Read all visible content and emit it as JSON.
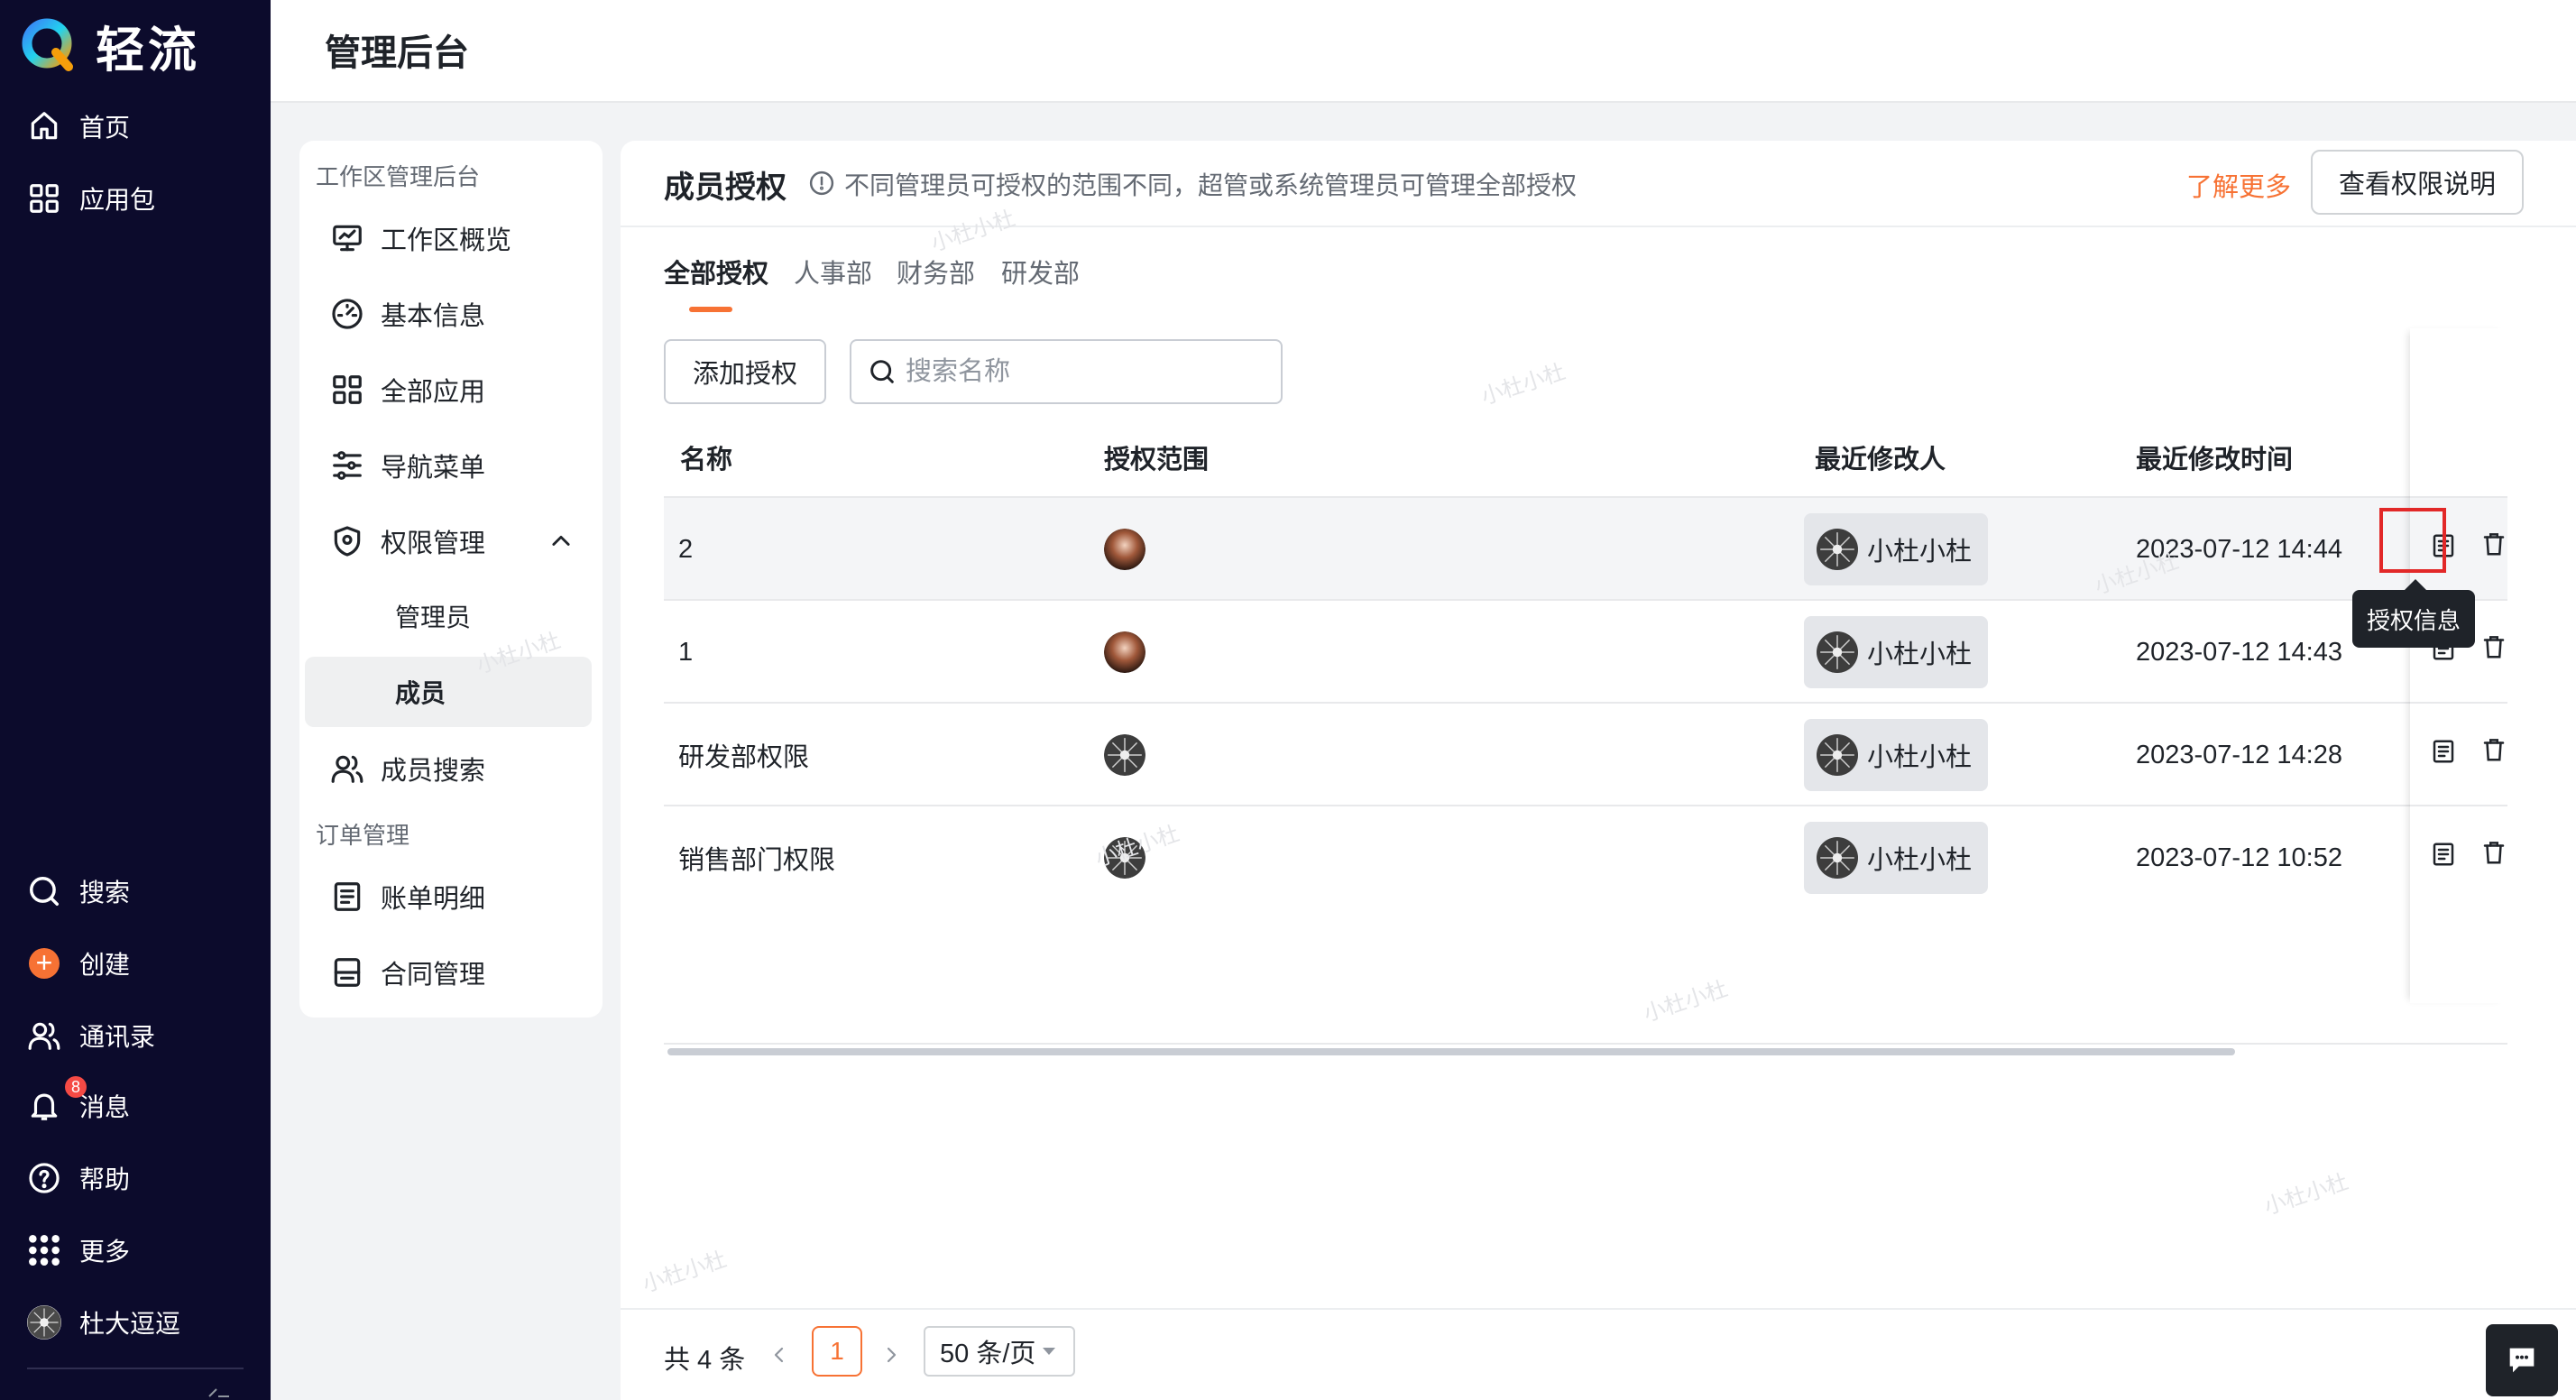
{
  "app": {
    "brand_name": "轻流",
    "header_title": "管理后台"
  },
  "sidebar": {
    "top_items": [
      {
        "label": "首页",
        "icon": "home-icon"
      },
      {
        "label": "应用包",
        "icon": "grid-icon"
      }
    ],
    "bottom_items": [
      {
        "label": "搜索",
        "icon": "search-icon"
      },
      {
        "label": "创建",
        "icon": "plus-icon"
      },
      {
        "label": "通讯录",
        "icon": "contacts-icon"
      },
      {
        "label": "消息",
        "icon": "bell-icon",
        "badge": "8"
      },
      {
        "label": "帮助",
        "icon": "help-icon"
      },
      {
        "label": "更多",
        "icon": "dots-grid-icon"
      }
    ],
    "user_name": "杜大逗逗"
  },
  "submenu": {
    "group1": "工作区管理后台",
    "items": [
      {
        "label": "工作区概览",
        "icon": "monitor-icon"
      },
      {
        "label": "基本信息",
        "icon": "dashboard-icon"
      },
      {
        "label": "全部应用",
        "icon": "apps-icon"
      },
      {
        "label": "导航菜单",
        "icon": "sliders-icon"
      },
      {
        "label": "权限管理",
        "icon": "shield-icon"
      }
    ],
    "sub_items": [
      {
        "label": "管理员"
      },
      {
        "label": "成员"
      }
    ],
    "member_search": "成员搜索",
    "group2": "订单管理",
    "order_items": [
      {
        "label": "账单明细",
        "icon": "bill-icon"
      },
      {
        "label": "合同管理",
        "icon": "contract-icon"
      }
    ]
  },
  "panel": {
    "title": "成员授权",
    "hint": "不同管理员可授权的范围不同，超管或系统管理员可管理全部授权",
    "learn_more": "了解更多",
    "perm_button": "查看权限说明",
    "tabs": [
      "全部授权",
      "人事部",
      "财务部",
      "研发部"
    ],
    "add_button": "添加授权",
    "search_placeholder": "搜索名称",
    "columns": [
      "名称",
      "授权范围",
      "最近修改人",
      "最近修改时间"
    ],
    "rows": [
      {
        "name": "2",
        "modifier": "小杜小杜",
        "time": "2023-07-12 14:44",
        "scope_avatar": "photo"
      },
      {
        "name": "1",
        "modifier": "小杜小杜",
        "time": "2023-07-12 14:43",
        "scope_avatar": "photo"
      },
      {
        "name": "研发部权限",
        "modifier": "小杜小杜",
        "time": "2023-07-12 14:28",
        "scope_avatar": "burst"
      },
      {
        "name": "销售部门权限",
        "modifier": "小杜小杜",
        "time": "2023-07-12 10:52",
        "scope_avatar": "burst"
      }
    ],
    "tooltip": "授权信息",
    "total": "共 4 条",
    "page": "1",
    "page_size": "50 条/页"
  },
  "watermark": "小杜小杜",
  "colors": {
    "sidebar_bg": "#0c0b2c",
    "accent": "#f77234",
    "highlight": "#e22828",
    "badge": "#f54a45"
  }
}
